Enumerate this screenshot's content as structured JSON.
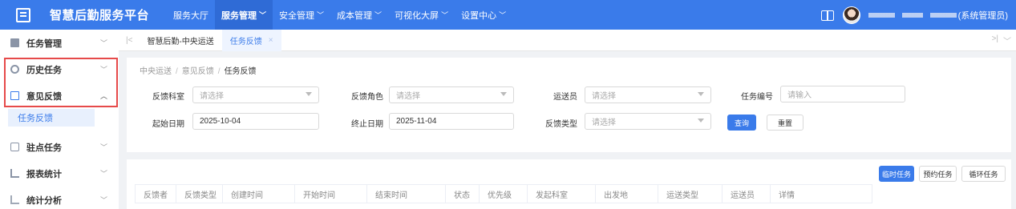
{
  "topbar": {
    "app_title": "智慧后勤服务平台",
    "nav": [
      {
        "label": "服务大厅",
        "has_chevron": false
      },
      {
        "label": "服务管理",
        "has_chevron": true
      },
      {
        "label": "安全管理",
        "has_chevron": true
      },
      {
        "label": "成本管理",
        "has_chevron": true
      },
      {
        "label": "可视化大屏",
        "has_chevron": true
      },
      {
        "label": "设置中心",
        "has_chevron": true
      }
    ],
    "active_nav": "服务管理",
    "user_role": "(系统管理员)",
    "icons": [
      "menu-logo-icon",
      "book-icon",
      "user-avatar"
    ]
  },
  "sidebar": {
    "items": [
      {
        "label": "任务管理",
        "icon": "task-icon"
      },
      {
        "label": "历史任务",
        "icon": "history-icon"
      },
      {
        "label": "意见反馈",
        "icon": "edit-icon",
        "expanded": true
      },
      {
        "label": "驻点任务",
        "icon": "station-icon"
      },
      {
        "label": "报表统计",
        "icon": "bar-chart-icon"
      },
      {
        "label": "统计分析",
        "icon": "analysis-icon"
      }
    ],
    "active_sub": "任务反馈"
  },
  "tabs": {
    "items": [
      {
        "label": "智慧后勤-中央运送"
      },
      {
        "label": "任务反馈",
        "active": true,
        "closable": true
      }
    ]
  },
  "breadcrumb": {
    "items": [
      "中央运送",
      "意见反馈"
    ],
    "current": "任务反馈"
  },
  "filters": {
    "feedback_dept": {
      "label": "反馈科室",
      "placeholder": "请选择"
    },
    "feedback_role": {
      "label": "反馈角色",
      "placeholder": "请选择"
    },
    "courier": {
      "label": "运送员",
      "placeholder": "请选择"
    },
    "task_no": {
      "label": "任务编号",
      "placeholder": "请输入"
    },
    "start_date": {
      "label": "起始日期",
      "value": "2025-10-04"
    },
    "end_date": {
      "label": "终止日期",
      "value": "2025-11-04"
    },
    "feedback_type": {
      "label": "反馈类型",
      "placeholder": "请选择"
    },
    "query_label": "查询",
    "reset_label": "重置"
  },
  "table_actions": {
    "temp_task": "临时任务",
    "scheduled_task": "预约任务",
    "cyclic_task": "循环任务"
  },
  "table": {
    "columns": [
      "反馈者",
      "反馈类型",
      "创建时间",
      "开始时间",
      "结束时间",
      "状态",
      "优先级",
      "发起科室",
      "出发地",
      "运送类型",
      "运送员",
      "详情"
    ]
  },
  "colors": {
    "primary": "#3a7bea",
    "highlight_border": "#e64a4a"
  }
}
